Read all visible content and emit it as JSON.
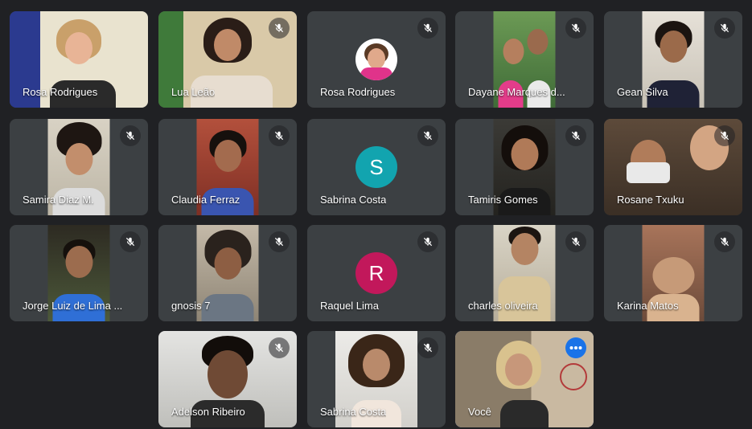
{
  "participants": [
    {
      "name": "Rosa Rodrigues"
    },
    {
      "name": "Lua Leão"
    },
    {
      "name": "Rosa Rodrigues"
    },
    {
      "name": "Dayane Marques d..."
    },
    {
      "name": "Gean Silva"
    },
    {
      "name": "Samira Diaz M."
    },
    {
      "name": "Claudia Ferraz"
    },
    {
      "name": "Sabrina Costa",
      "initial": "S"
    },
    {
      "name": "Tamiris Gomes"
    },
    {
      "name": "Rosane Txuku"
    },
    {
      "name": "Jorge Luiz de Lima ..."
    },
    {
      "name": "gnosis 7"
    },
    {
      "name": "Raquel Lima",
      "initial": "R"
    },
    {
      "name": "charles oliveira"
    },
    {
      "name": "Karina Matos"
    },
    {
      "name": "Adelson Ribeiro"
    },
    {
      "name": "Sabrina Costa"
    },
    {
      "name": "Você"
    }
  ],
  "colors": {
    "background": "#202124",
    "tile": "#3c4043",
    "avatar_sabrina": "#12a4af",
    "avatar_raquel": "#c2185b",
    "active_border": "#8ab4f8",
    "more_button": "#1a73e8"
  },
  "icons": {
    "mute": "mic-off-icon",
    "more": "more-options-icon"
  }
}
